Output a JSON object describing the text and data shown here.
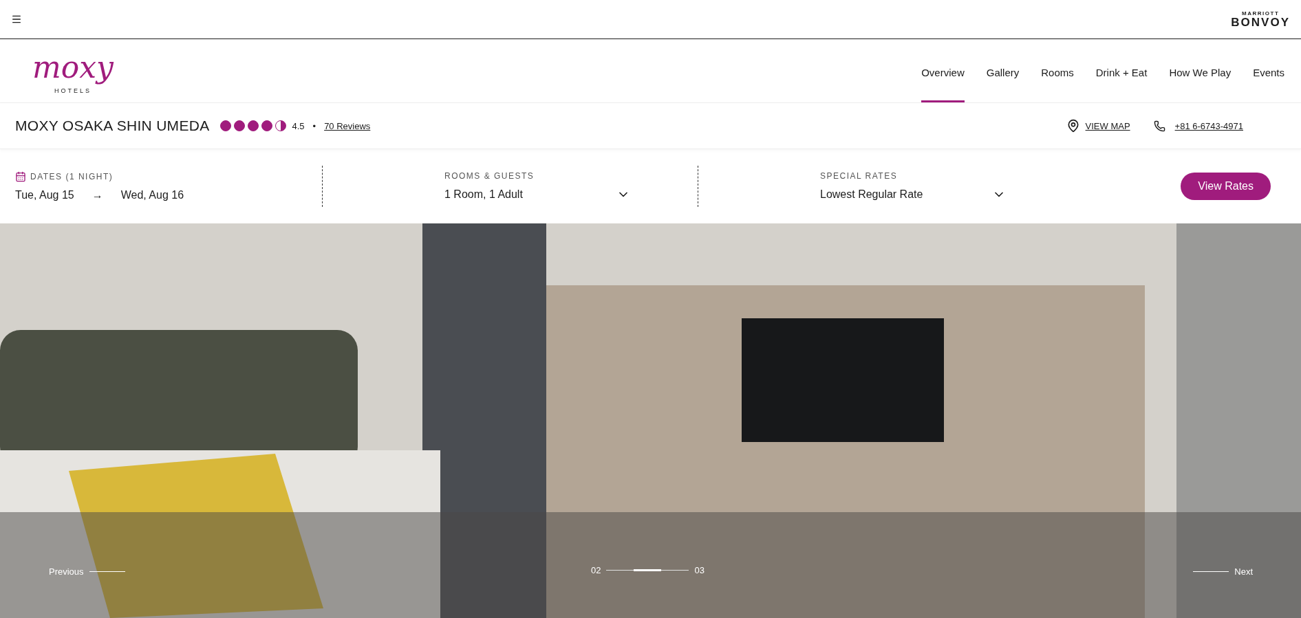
{
  "top_bar": {
    "brand_small": "MARRIOTT",
    "brand_large": "BONVOY"
  },
  "logo": {
    "wordmark": "moxy",
    "subtitle": "HOTELS"
  },
  "nav": [
    {
      "label": "Overview",
      "selected": true
    },
    {
      "label": "Gallery",
      "selected": false
    },
    {
      "label": "Rooms",
      "selected": false
    },
    {
      "label": "Drink + Eat",
      "selected": false
    },
    {
      "label": "How We Play",
      "selected": false
    },
    {
      "label": "Events",
      "selected": false
    }
  ],
  "hotel": {
    "name": "MOXY OSAKA SHIN UMEDA",
    "stars": 4.5,
    "rating": "4.5",
    "separator": "•",
    "reviews": "70 Reviews",
    "map_link": "VIEW MAP",
    "phone": "+81 6-6743-4971"
  },
  "booking": {
    "dates_label": "DATES (1 NIGHT)",
    "check_in": "Tue, Aug 15",
    "arrow": "→",
    "check_out": "Wed, Aug 16",
    "rooms_label": "ROOMS & GUESTS",
    "rooms_value": "1 Room, 1 Adult",
    "rates_label": "SPECIAL RATES",
    "rates_value": "Lowest Regular Rate",
    "button": "View Rates"
  },
  "carousel": {
    "previous": "Previous",
    "next": "Next",
    "current": "02",
    "following": "03"
  }
}
